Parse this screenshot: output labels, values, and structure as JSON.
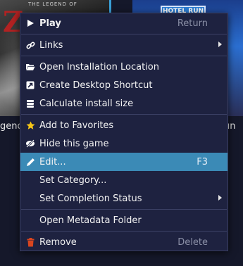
{
  "background": {
    "left_tile": {
      "title": "gend",
      "logo_text": "Z",
      "sub_text": "THE LEGEND OF"
    },
    "right_tile": {
      "title": "un",
      "sign_text": "HOTEL RUN"
    }
  },
  "menu": {
    "items": [
      {
        "label": "Play",
        "shortcut": "Return",
        "icon": "play-icon"
      },
      {
        "label": "Links",
        "submenu": true,
        "icon": "link-icon"
      },
      {
        "label": "Open Installation Location",
        "icon": "folder-open-icon"
      },
      {
        "label": "Create Desktop Shortcut",
        "icon": "external-link-icon"
      },
      {
        "label": "Calculate install size",
        "icon": "database-icon"
      },
      {
        "label": "Add to Favorites",
        "icon": "star-icon"
      },
      {
        "label": "Hide this game",
        "icon": "eye-slash-icon"
      },
      {
        "label": "Edit...",
        "shortcut": "F3",
        "icon": "pencil-icon",
        "highlighted": true
      },
      {
        "label": "Set Category..."
      },
      {
        "label": "Set Completion Status",
        "submenu": true
      },
      {
        "label": "Open Metadata Folder"
      },
      {
        "label": "Remove",
        "shortcut": "Delete",
        "icon": "trash-icon"
      }
    ]
  },
  "colors": {
    "menu_bg": "#1e2240",
    "highlight": "#3b8ab6",
    "star": "#f5c518",
    "trash": "#d9451f",
    "selection_border": "#3aa0d8"
  }
}
